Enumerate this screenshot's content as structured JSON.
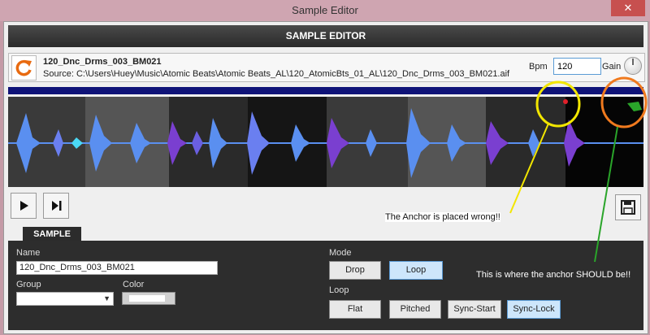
{
  "window": {
    "title": "Sample Editor",
    "close_label": "✕"
  },
  "header": {
    "title": "SAMPLE EDITOR"
  },
  "sample_info": {
    "filename": "120_Dnc_Drms_003_BM021",
    "source": "Source: C:\\Users\\Huey\\Music\\Atomic Beats\\Atomic Beats_AL\\120_AtomicBts_01_AL\\120_Dnc_Drms_003_BM021.aif",
    "bpm_label": "Bpm",
    "bpm_value": "120",
    "gain_label": "Gain"
  },
  "transport": {
    "play_icon": "play-icon",
    "skip_icon": "skip-to-end-icon",
    "save_icon": "save-icon"
  },
  "tab": {
    "label": "SAMPLE"
  },
  "panel": {
    "name_label": "Name",
    "name_value": "120_Dnc_Drms_003_BM021",
    "group_label": "Group",
    "group_value": "",
    "color_label": "Color",
    "mode_label": "Mode",
    "mode_buttons": [
      "Drop",
      "Loop"
    ],
    "mode_selected": "Loop",
    "loop_label": "Loop",
    "loop_buttons": [
      "Flat",
      "Pitched",
      "Sync-Start",
      "Sync-Lock"
    ],
    "loop_selected": "Sync-Lock"
  },
  "annotations": {
    "wrong_text": "The Anchor is placed wrong!!",
    "should_text": "This is where the anchor SHOULD be!!",
    "colors": {
      "yellow": "#f2e600",
      "orange": "#f07a1e",
      "green": "#2aa52a"
    }
  },
  "colors": {
    "waveform_blue": "#5a8ff0",
    "waveform_purple": "#7a3fd0",
    "waveform_cyan": "#4ad8f5",
    "navy_bar": "#0f1378",
    "accent_orange": "#e86a10",
    "active_button": "#cde6fb"
  }
}
